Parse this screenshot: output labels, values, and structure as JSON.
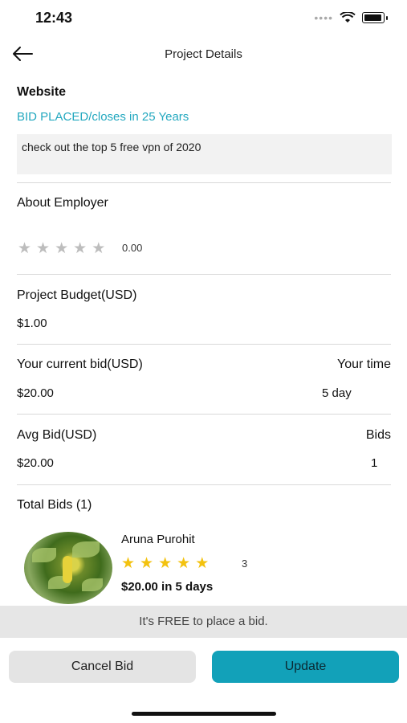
{
  "status": {
    "time": "12:43"
  },
  "header": {
    "title": "Project Details",
    "back_icon": "arrow-left-icon"
  },
  "project": {
    "title": "Website",
    "status_line": "BID PLACED/closes in  25 Years",
    "description": "check out the top 5 free vpn of 2020"
  },
  "employer": {
    "heading": "About Employer",
    "rating": "0.00",
    "stars_filled": 0,
    "stars_total": 5
  },
  "budget": {
    "label": "Project Budget(USD)",
    "value": "$1.00"
  },
  "current_bid": {
    "label": "Your current bid(USD)",
    "value": "$20.00",
    "time_label": "Your time",
    "time_value": "5 day"
  },
  "avg_bid": {
    "label": "Avg Bid(USD)",
    "value": "$20.00",
    "bids_label": "Bids",
    "bids_value": "1"
  },
  "total_bids": {
    "heading": "Total Bids (1)"
  },
  "bidder": {
    "name": "Aruna Purohit",
    "stars_filled": 5,
    "rating_count": "3",
    "bid_text": "$20.00 in 5 days"
  },
  "free_notice": "It's FREE to place a bid.",
  "actions": {
    "cancel_label": "Cancel Bid",
    "update_label": "Update"
  },
  "colors": {
    "accent": "#23a8bf",
    "update_button": "#12a1b9",
    "star": "#f3c20f"
  }
}
